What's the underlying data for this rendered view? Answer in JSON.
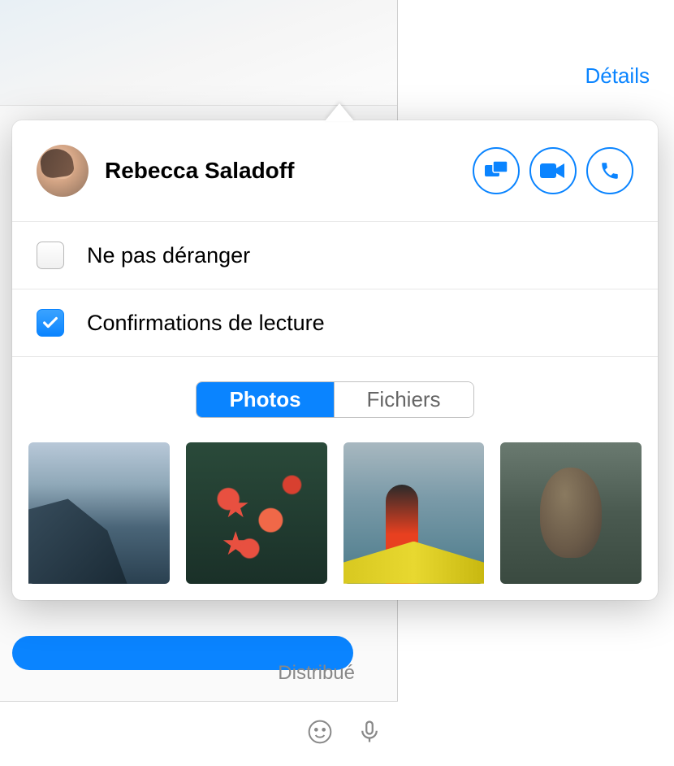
{
  "header": {
    "details_link": "Détails"
  },
  "contact": {
    "name": "Rebecca Saladoff"
  },
  "actions": {
    "screenshare": {
      "name": "screenshare-icon"
    },
    "video": {
      "name": "video-icon"
    },
    "audio": {
      "name": "phone-icon"
    }
  },
  "options": {
    "dnd": {
      "label": "Ne pas déranger",
      "checked": false
    },
    "read_receipts": {
      "label": "Confirmations de lecture",
      "checked": true
    }
  },
  "tabs": {
    "photos": "Photos",
    "files": "Fichiers",
    "active": "photos"
  },
  "status": {
    "delivered": "Distribué"
  },
  "colors": {
    "accent": "#0a84ff"
  }
}
